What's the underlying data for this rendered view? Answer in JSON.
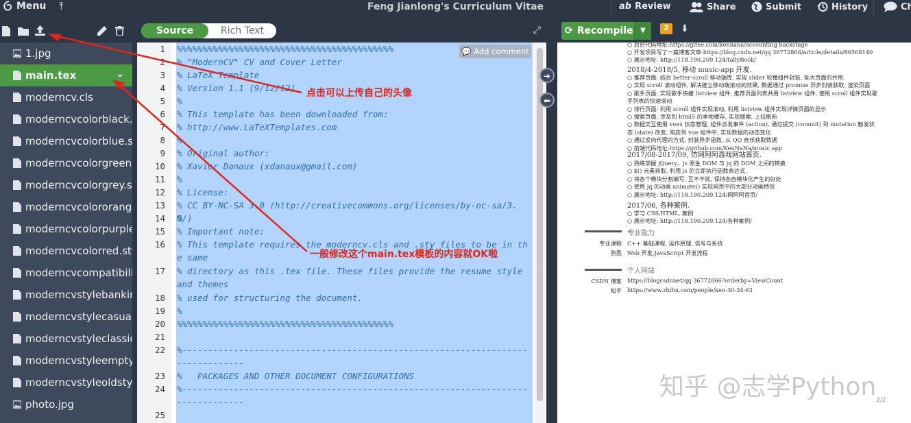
{
  "topbar": {
    "menu_label": "Menu",
    "title": "Feng Jianlong's Curriculum Vitae",
    "review_label": "Review",
    "share_label": "Share",
    "submit_label": "Submit",
    "history_label": "History",
    "chat_label": "Ch"
  },
  "sidebar": {
    "files": [
      {
        "name": "1.jpg",
        "icon": "image-icon"
      },
      {
        "name": "main.tex",
        "icon": "file-icon",
        "active": true
      },
      {
        "name": "moderncv.cls",
        "icon": "file-icon"
      },
      {
        "name": "moderncvcolorblack.sty",
        "icon": "file-icon"
      },
      {
        "name": "moderncvcolorblue.sty",
        "icon": "file-icon"
      },
      {
        "name": "moderncvcolorgreen.sty",
        "icon": "file-icon"
      },
      {
        "name": "moderncvcolorgrey.sty",
        "icon": "file-icon"
      },
      {
        "name": "moderncvcolororange.sty",
        "icon": "file-icon"
      },
      {
        "name": "moderncvcolorpurple.sty",
        "icon": "file-icon"
      },
      {
        "name": "moderncvcolorred.sty",
        "icon": "file-icon"
      },
      {
        "name": "moderncvcompatibility.sty",
        "icon": "file-icon"
      },
      {
        "name": "moderncvstylebanking.sty",
        "icon": "file-icon"
      },
      {
        "name": "moderncvstylecasual.sty",
        "icon": "file-icon"
      },
      {
        "name": "moderncvstyleclassic.sty",
        "icon": "file-icon"
      },
      {
        "name": "moderncvstyleempty.sty",
        "icon": "file-icon"
      },
      {
        "name": "moderncvstyleoldstyle.sty",
        "icon": "file-icon"
      },
      {
        "name": "photo.jpg",
        "icon": "image-icon"
      }
    ]
  },
  "editor": {
    "source_label": "Source",
    "richtext_label": "Rich Text",
    "add_comment_label": "Add comment",
    "lines": [
      {
        "n": "1",
        "text": "%%%%%%%%%%%%%%%%%%%%%%%%%%%%%%%%%%%%%%%%%%"
      },
      {
        "n": "2",
        "text": "% \"ModernCV\" CV and Cover Letter"
      },
      {
        "n": "3",
        "text": "% LaTeX Template"
      },
      {
        "n": "4",
        "text": "% Version 1.1 (9/12/12)"
      },
      {
        "n": "5",
        "text": "%"
      },
      {
        "n": "6",
        "text": "% This template has been downloaded from:"
      },
      {
        "n": "7",
        "text": "% http://www.LaTeXTemplates.com"
      },
      {
        "n": "8",
        "text": "%"
      },
      {
        "n": "9",
        "text": "% Original author:"
      },
      {
        "n": "10",
        "text": "% Xavier Danaux (xdanaux@gmail.com)"
      },
      {
        "n": "11",
        "text": "%"
      },
      {
        "n": "12",
        "text": "% License:"
      },
      {
        "n": "13",
        "text": "% CC BY-NC-SA 3.0 (http://creativecommons.org/licenses/by-nc-sa/3.0/)"
      },
      {
        "n": "14",
        "text": "%"
      },
      {
        "n": "15",
        "text": "% Important note:"
      },
      {
        "n": "16",
        "text": "% This template requires the moderncv.cls and .sty files to be in the same"
      },
      {
        "n": "17",
        "text": "% directory as this .tex file. These files provide the resume style and themes"
      },
      {
        "n": "18",
        "text": "% used for structuring the document."
      },
      {
        "n": "19",
        "text": "%"
      },
      {
        "n": "20",
        "text": "%%%%%%%%%%%%%%%%%%%%%%%%%%%%%%%%%%%%%%%%%%"
      },
      {
        "n": "21",
        "text": ""
      },
      {
        "n": "22",
        "text": "%--------------------------------------------------------------------------------"
      },
      {
        "n": "23",
        "text": "%   PACKAGES AND OTHER DOCUMENT CONFIGURATIONS"
      },
      {
        "n": "24",
        "text": "%--------------------------------------------------------------------------------"
      },
      {
        "n": "25",
        "text": ""
      }
    ]
  },
  "pdf": {
    "recompile_label": "Recompile",
    "log_count": "2",
    "page_indicator": "2/2",
    "lines_top": [
      "○ 后台代码地址:https://gitee.com/kennana/accounting   backstage",
      "○ 开发项目写了一篇博客文章:https://blog.csdn.net/qq   36772866/article/details/86568140",
      "○ 展示地址: http://118.190.209.124/tallyBook/"
    ],
    "entry2_head": "2018/4-2018/5, 移动 music-app 开发.",
    "entry2_lines": [
      "○ 推荐页面: 结合 better-scroll 移动端库, 实现 slider 轮播组件封装, 各大页面的共用.",
      "○ 实现 scroll 滚动组件, 解决建立移动端滚动的效果, 数据通过 promise 异步封装获取, 渲染页面",
      "○ 歌手页面: 实现歌手快捷 listview 组件, 推荐页面列表共用 listview 组件, 使用 scroll 组件实现歌",
      "   手列表的快速滚动",
      "○ 排行页面: 利用 scroll 组件实现滚动, 利用 listview 组件实现详情页面的显示",
      "○ 搜索页面: 涉及到 html5 的本地缓存, 实现搜索, 上拉刷新",
      "○ 数据交互使用 vuex 状态管理, 组件派发事件 (action), 通过提交 (commit) 到 mutation 触发状",
      "   态 (state) 改变, 响应到 vue 组件中, 实现数据的动态变化",
      "○ 通过反向代理的方式, 封装异步函数, 从 QQ 音乐获取数据",
      "○ 前端代码地址:https://github.com/KenNaNa/music  app"
    ],
    "entry3_head": "2017/08-2017/09, 仿网阿阿游戏网站首页.",
    "entry3_lines": [
      "○ 熟练掌握 jQuery、js 原生 DOM 与 jq 的 DOM 之间的转换",
      "○ $() 元素获取, 利用 js 的立即执行函数表达式.",
      "○ 将各个模块分割编写, 互不干扰, 保持各自模块化产生的好处",
      "○ 使用 jq 的动画 animate() 实现网页中的大部分动画特效",
      "○ 展示地址: http://118.190.209.124/网阿阿首页/"
    ],
    "entry4_head": "2017/06, 各种案例.",
    "entry4_lines": [
      "○ 学习 CSS,HTML, 案例",
      "○ 展示地址: http://118.190.209.124/各种案例/"
    ],
    "section_skills": "专业能力",
    "skills": [
      {
        "label": "专业课程",
        "value": "C++ 基础课程, 运作原理, 信号与系统"
      },
      {
        "label": "熟悉",
        "value": "Web 开发,JavaScript 开发流程"
      }
    ],
    "section_sites": "个人网站",
    "sites": [
      {
        "label": "CSDN 博客",
        "value": "https://blogcsdnnet/qq   36772866?orderby=ViewCount"
      },
      {
        "label": "知乎",
        "value": "https://www.zhihu.com/people/ken-30-34-63"
      }
    ]
  },
  "annotations": {
    "upload_note": "点击可以上传自己的头像",
    "edit_note": "一般修改这个main.tex模板的内容就OK啦",
    "watermark": "知乎 @志学Python"
  },
  "colors": {
    "accent": "#4c9a44",
    "chrome": "#2c3645",
    "sidebar": "#3e4a5b",
    "annotation": "#e1251b"
  }
}
